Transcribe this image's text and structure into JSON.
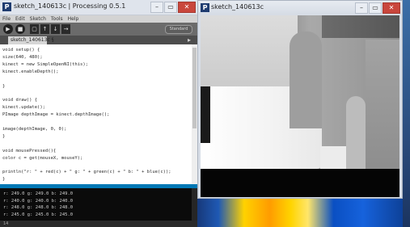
{
  "ide": {
    "title": "sketch_140613c | Processing 0.5.1",
    "window_buttons": [
      "–",
      "▭",
      "✕"
    ],
    "menu": [
      "File",
      "Edit",
      "Sketch",
      "Tools",
      "Help"
    ],
    "toolbar": {
      "run": "▶",
      "stop": "■",
      "new": "▢",
      "open": "↑",
      "save": "↓",
      "export": "→",
      "mode": "Standard"
    },
    "tab_label": "sketch_140613c §",
    "tab_menu": "▸",
    "code": [
      "void setup() {",
      "size(640, 480);",
      "kinect = new SimpleOpenNI(this);",
      "kinect.enableDepth();",
      "",
      "}",
      "",
      "void draw() {",
      "kinect.update();",
      "PImage depthImage = kinect.depthImage();",
      "",
      "image(depthImage, 0, 0);",
      " }",
      "",
      "void mousePressed(){",
      "color c = get(mouseX, mouseY);",
      "",
      "println(\"r: \" + red(c) + \" g: \" + green(c) + \" b: \" + blue(c));",
      "}"
    ],
    "console": [
      "r: 249.0 g: 249.0 b: 249.0",
      "r: 240.0 g: 240.0 b: 240.0",
      "r: 248.0 g: 248.0 b: 248.0",
      "r: 245.0 g: 245.0 b: 245.0"
    ],
    "status_line": "14"
  },
  "sketch": {
    "title": "sketch_140613c",
    "window_buttons": [
      "–",
      "▭",
      "✕"
    ]
  },
  "colors": {
    "toolbar": "#6b6b6b",
    "tabbar": "#4d4d4d",
    "console_bg": "#0b0b0b",
    "message_bar": "#0078b5",
    "titlebar": "#dfe4ec",
    "close_button": "#c9463c"
  },
  "icons": {
    "app_logo": "processing-logo-icon",
    "run": "play-icon",
    "stop": "stop-icon",
    "new": "new-file-icon",
    "open": "open-icon",
    "save": "save-icon",
    "export": "export-icon"
  }
}
